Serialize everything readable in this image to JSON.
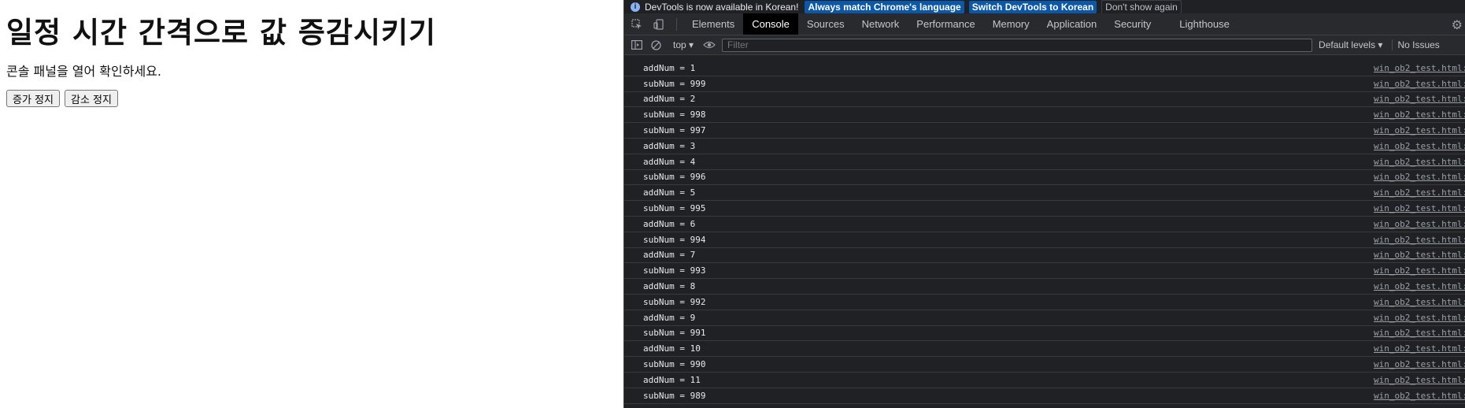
{
  "page": {
    "title": "일정 시간 간격으로 값 증감시키기",
    "description": "콘솔 패널을 열어 확인하세요.",
    "buttons": {
      "stop_increase": "증가 정지",
      "stop_decrease": "감소 정지"
    }
  },
  "devtools": {
    "infobar": {
      "message": "DevTools is now available in Korean!",
      "match_language": "Always match Chrome's language",
      "switch_language": "Switch DevTools to Korean",
      "dismiss": "Don't show again"
    },
    "tabs": [
      "Elements",
      "Console",
      "Sources",
      "Network",
      "Performance",
      "Memory",
      "Application",
      "Security",
      "Lighthouse"
    ],
    "active_tab": "Console",
    "toolbar": {
      "context": "top ▾",
      "filter_placeholder": "Filter",
      "levels": "Default levels ▾",
      "issues": "No Issues"
    },
    "log": [
      {
        "message": "addNum = 1",
        "source": "win_ob2_test.html:"
      },
      {
        "message": "subNum = 999",
        "source": "win_ob2_test.html:"
      },
      {
        "message": "addNum = 2",
        "source": "win_ob2_test.html:"
      },
      {
        "message": "subNum = 998",
        "source": "win_ob2_test.html:"
      },
      {
        "message": "subNum = 997",
        "source": "win_ob2_test.html:"
      },
      {
        "message": "addNum = 3",
        "source": "win_ob2_test.html:"
      },
      {
        "message": "addNum = 4",
        "source": "win_ob2_test.html:"
      },
      {
        "message": "subNum = 996",
        "source": "win_ob2_test.html:"
      },
      {
        "message": "addNum = 5",
        "source": "win_ob2_test.html:"
      },
      {
        "message": "subNum = 995",
        "source": "win_ob2_test.html:"
      },
      {
        "message": "addNum = 6",
        "source": "win_ob2_test.html:"
      },
      {
        "message": "subNum = 994",
        "source": "win_ob2_test.html:"
      },
      {
        "message": "addNum = 7",
        "source": "win_ob2_test.html:"
      },
      {
        "message": "subNum = 993",
        "source": "win_ob2_test.html:"
      },
      {
        "message": "addNum = 8",
        "source": "win_ob2_test.html:"
      },
      {
        "message": "subNum = 992",
        "source": "win_ob2_test.html:"
      },
      {
        "message": "addNum = 9",
        "source": "win_ob2_test.html:"
      },
      {
        "message": "subNum = 991",
        "source": "win_ob2_test.html:"
      },
      {
        "message": "addNum = 10",
        "source": "win_ob2_test.html:"
      },
      {
        "message": "subNum = 990",
        "source": "win_ob2_test.html:"
      },
      {
        "message": "addNum = 11",
        "source": "win_ob2_test.html:"
      },
      {
        "message": "subNum = 989",
        "source": "win_ob2_test.html:"
      }
    ]
  },
  "colors": {
    "devtools_bg": "#202124",
    "info_button_bg": "#0b57a8",
    "active_tab_bg": "#000000"
  },
  "icons": [
    "info-icon",
    "inspect-icon",
    "device-toolbar-icon",
    "settings-gear-icon",
    "sidebar-toggle-icon",
    "clear-console-icon",
    "eye-icon"
  ]
}
